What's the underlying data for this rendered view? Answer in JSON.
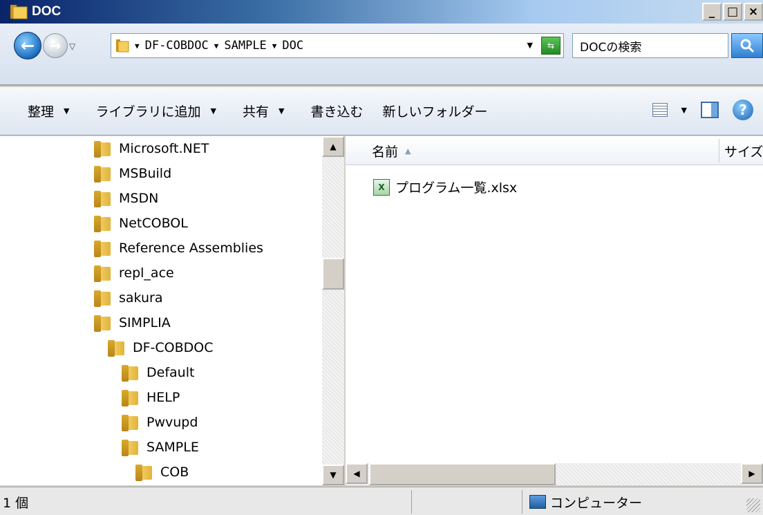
{
  "window": {
    "title": "DOC"
  },
  "address": {
    "segments": [
      "DF-COBDOC",
      "SAMPLE",
      "DOC"
    ]
  },
  "search": {
    "placeholder": "DOCの検索"
  },
  "toolbar": {
    "organize": "整理",
    "add_library": "ライブラリに追加",
    "share": "共有",
    "burn": "書き込む",
    "new_folder": "新しいフォルダー"
  },
  "tree": {
    "items": [
      {
        "label": "Microsoft.NET",
        "level": 0
      },
      {
        "label": "MSBuild",
        "level": 0
      },
      {
        "label": "MSDN",
        "level": 0
      },
      {
        "label": "NetCOBOL",
        "level": 0
      },
      {
        "label": "Reference Assemblies",
        "level": 0
      },
      {
        "label": "repl_ace",
        "level": 0
      },
      {
        "label": "sakura",
        "level": 0
      },
      {
        "label": "SIMPLIA",
        "level": 0
      },
      {
        "label": "DF-COBDOC",
        "level": 1
      },
      {
        "label": "Default",
        "level": 2
      },
      {
        "label": "HELP",
        "level": 2
      },
      {
        "label": "Pwvupd",
        "level": 2
      },
      {
        "label": "SAMPLE",
        "level": 2
      },
      {
        "label": "COB",
        "level": 3
      }
    ]
  },
  "list": {
    "columns": {
      "name": "名前",
      "size": "サイズ"
    },
    "files": [
      {
        "name": "プログラム一覧.xlsx"
      }
    ]
  },
  "status": {
    "count": "1 個",
    "location": "コンピューター"
  }
}
